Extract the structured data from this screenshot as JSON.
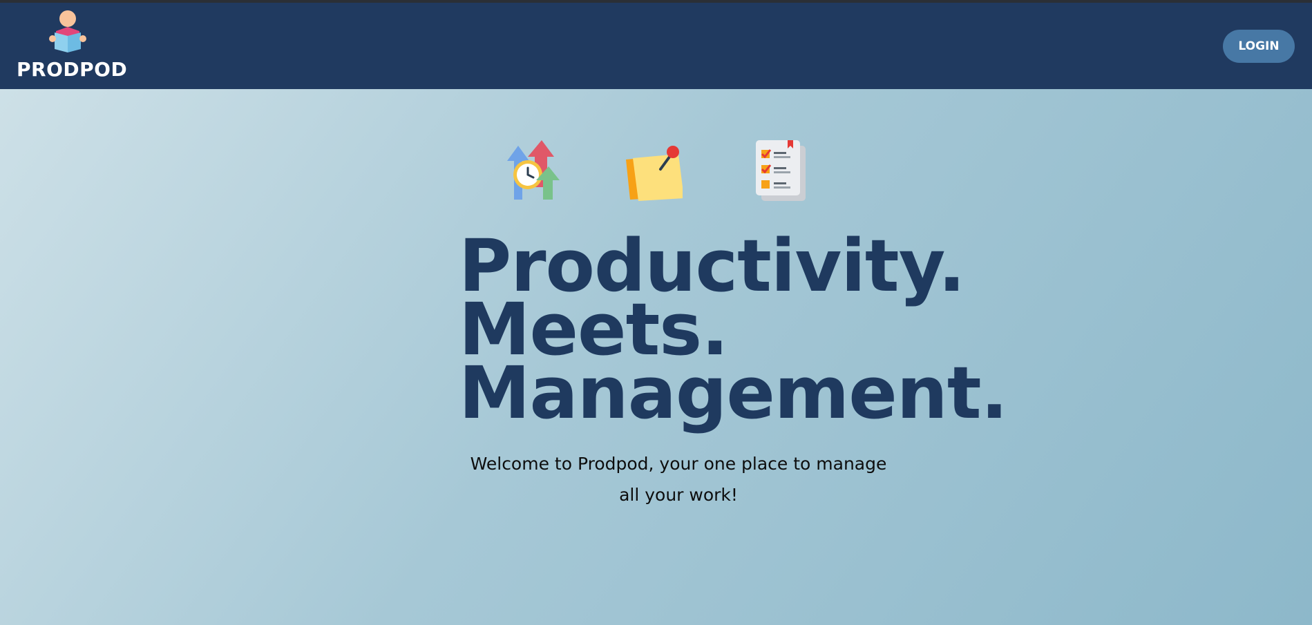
{
  "header": {
    "brand_name": "PRODPOD",
    "brand_icon": "person-reading-book-icon",
    "login_label": "LOGIN"
  },
  "hero": {
    "icons": [
      "productivity-growth-icon",
      "sticky-note-icon",
      "checklist-icon"
    ],
    "headline": [
      "Productivity.",
      "Meets.",
      "Management."
    ],
    "subtitle": [
      "Welcome to Prodpod, your one place to manage",
      "all your work!"
    ]
  },
  "colors": {
    "navbar": "#203a60",
    "login_button": "#4778a5",
    "headline": "#1f3a5f"
  }
}
